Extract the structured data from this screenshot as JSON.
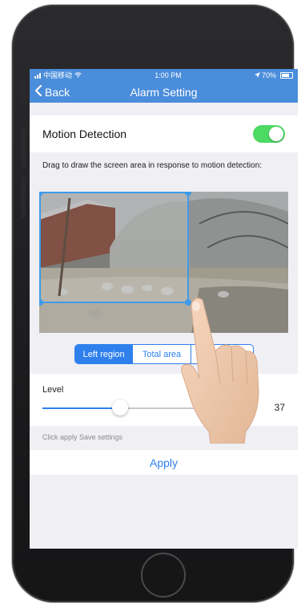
{
  "status_bar": {
    "carrier": "中国移动",
    "time": "1:00 PM",
    "battery": "70%"
  },
  "nav": {
    "back_label": "Back",
    "title": "Alarm Setting"
  },
  "motion": {
    "label": "Motion Detection",
    "enabled": true
  },
  "drag_hint": "Drag to draw the screen area in response to motion detection:",
  "regions": {
    "options": [
      "Left region",
      "Total area",
      "Right region"
    ],
    "visible_labels": [
      "Left region",
      "Total area",
      "ion"
    ],
    "selected": "Left region"
  },
  "level": {
    "label": "Level",
    "value": "37",
    "fraction": 0.37
  },
  "apply": {
    "hint": "Click apply Save settings",
    "label": "Apply"
  },
  "colors": {
    "nav_blue": "#4a8ddb",
    "accent_blue": "#2f80ed",
    "toggle_green": "#4cd964"
  }
}
